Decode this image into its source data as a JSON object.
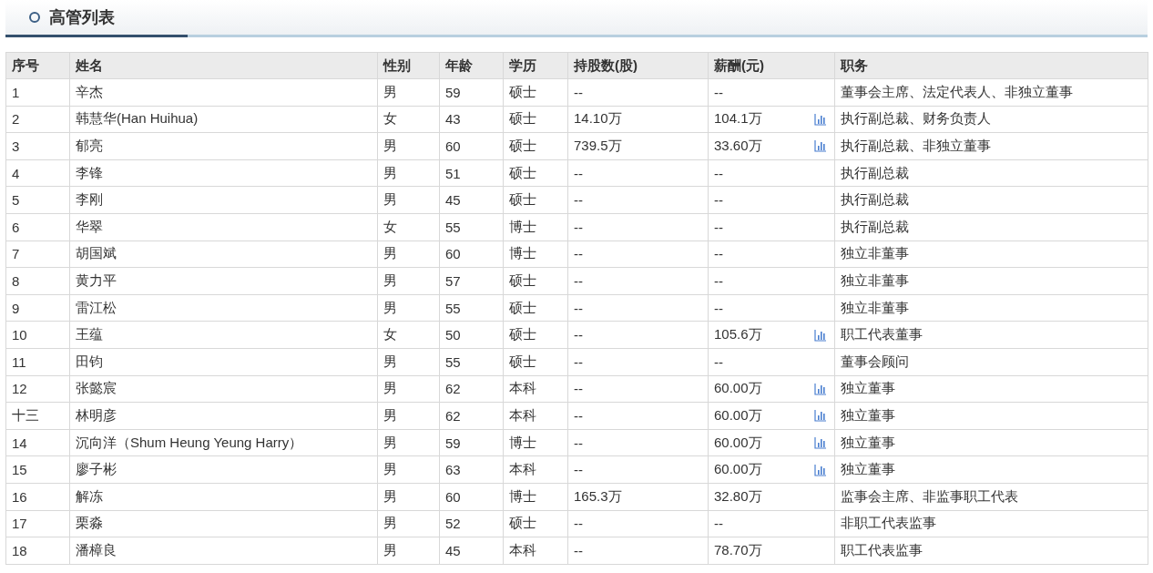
{
  "title": "高管列表",
  "table": {
    "columns": [
      "序号",
      "姓名",
      "性别",
      "年龄",
      "学历",
      "持股数(股)",
      "薪酬(元)",
      "职务"
    ],
    "rows": [
      {
        "cells": [
          "1",
          "辛杰",
          "男",
          "59",
          "硕士",
          "--",
          "--",
          "董事会主席、法定代表人、非独立董事"
        ],
        "has_chart_icon": false
      },
      {
        "cells": [
          "2",
          "韩慧华(Han Huihua)",
          "女",
          "43",
          "硕士",
          "14.10万",
          "104.1万",
          "执行副总裁、财务负责人"
        ],
        "has_chart_icon": true
      },
      {
        "cells": [
          "3",
          "郁亮",
          "男",
          "60",
          "硕士",
          "739.5万",
          "33.60万",
          "执行副总裁、非独立董事"
        ],
        "has_chart_icon": true
      },
      {
        "cells": [
          "4",
          "李锋",
          "男",
          "51",
          "硕士",
          "--",
          "--",
          "执行副总裁"
        ],
        "has_chart_icon": false
      },
      {
        "cells": [
          "5",
          "李刚",
          "男",
          "45",
          "硕士",
          "--",
          "--",
          "执行副总裁"
        ],
        "has_chart_icon": false
      },
      {
        "cells": [
          "6",
          "华翠",
          "女",
          "55",
          "博士",
          "--",
          "--",
          "执行副总裁"
        ],
        "has_chart_icon": false
      },
      {
        "cells": [
          "7",
          "胡国斌",
          "男",
          "60",
          "博士",
          "--",
          "--",
          "独立非董事"
        ],
        "has_chart_icon": false
      },
      {
        "cells": [
          "8",
          "黄力平",
          "男",
          "57",
          "硕士",
          "--",
          "--",
          "独立非董事"
        ],
        "has_chart_icon": false
      },
      {
        "cells": [
          "9",
          "雷江松",
          "男",
          "55",
          "硕士",
          "--",
          "--",
          "独立非董事"
        ],
        "has_chart_icon": false
      },
      {
        "cells": [
          "10",
          "王蕴",
          "女",
          "50",
          "硕士",
          "--",
          "105.6万",
          "职工代表董事"
        ],
        "has_chart_icon": true
      },
      {
        "cells": [
          "11",
          "田钧",
          "男",
          "55",
          "硕士",
          "--",
          "--",
          "董事会顾问"
        ],
        "has_chart_icon": false
      },
      {
        "cells": [
          "12",
          "张懿宸",
          "男",
          "62",
          "本科",
          "--",
          "60.00万",
          "独立董事"
        ],
        "has_chart_icon": true
      },
      {
        "cells": [
          "十三",
          "林明彦",
          "男",
          "62",
          "本科",
          "--",
          "60.00万",
          "独立董事"
        ],
        "has_chart_icon": true
      },
      {
        "cells": [
          "14",
          "沉向洋（Shum Heung Yeung Harry）",
          "男",
          "59",
          "博士",
          "--",
          "60.00万",
          "独立董事"
        ],
        "has_chart_icon": true
      },
      {
        "cells": [
          "15",
          "廖子彬",
          "男",
          "63",
          "本科",
          "--",
          "60.00万",
          "独立董事"
        ],
        "has_chart_icon": true
      },
      {
        "cells": [
          "16",
          "解冻",
          "男",
          "60",
          "博士",
          "165.3万",
          "32.80万",
          "监事会主席、非监事职工代表"
        ],
        "has_chart_icon": false
      },
      {
        "cells": [
          "17",
          "栗淼",
          "男",
          "52",
          "硕士",
          "--",
          "--",
          "非职工代表监事"
        ],
        "has_chart_icon": false
      },
      {
        "cells": [
          "18",
          "潘樟良",
          "男",
          "45",
          "本科",
          "--",
          "78.70万",
          "职工代表监事"
        ],
        "has_chart_icon": false
      }
    ]
  }
}
